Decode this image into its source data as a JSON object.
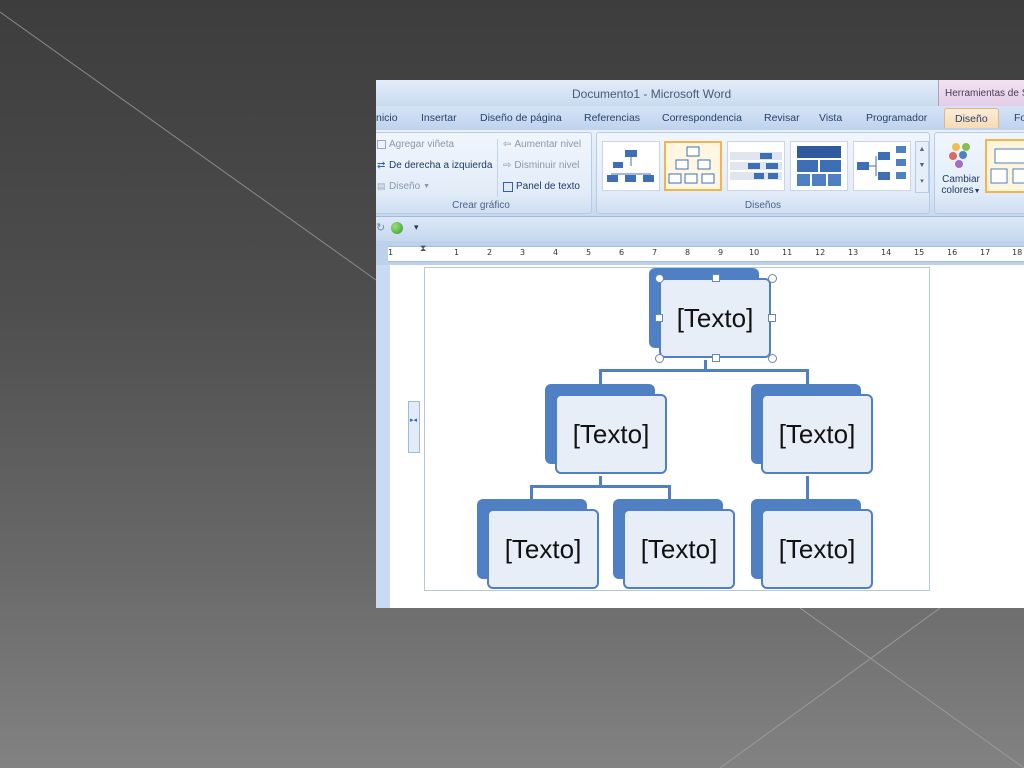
{
  "window": {
    "title": "Documento1 - Microsoft Word",
    "context_header": "Herramientas de S"
  },
  "tabs": [
    {
      "label": "nicio"
    },
    {
      "label": "Insertar"
    },
    {
      "label": "Diseño de página"
    },
    {
      "label": "Referencias"
    },
    {
      "label": "Correspondencia"
    },
    {
      "label": "Revisar"
    },
    {
      "label": "Vista"
    },
    {
      "label": "Programador"
    },
    {
      "label": "Diseño",
      "active": true
    },
    {
      "label": "Fo"
    }
  ],
  "ribbon": {
    "crear_grafico": {
      "label": "Crear gráfico",
      "agregar_vineta": "Agregar viñeta",
      "derecha_izquierda": "De derecha a izquierda",
      "diseno": "Diseño",
      "aumentar_nivel": "Aumentar nivel",
      "disminuir_nivel": "Disminuir nivel",
      "panel_texto": "Panel de texto"
    },
    "disenos": {
      "label": "Diseños"
    },
    "cambiar_colores": {
      "line1": "Cambiar",
      "line2": "colores"
    }
  },
  "ruler": {
    "numbers": [
      "1",
      "1",
      "2",
      "3",
      "4",
      "5",
      "6",
      "7",
      "8",
      "9",
      "10",
      "11",
      "12",
      "13",
      "14",
      "15",
      "16",
      "17",
      "18"
    ]
  },
  "smartart": {
    "nodes": [
      "[Texto]",
      "[Texto]",
      "[Texto]",
      "[Texto]",
      "[Texto]",
      "[Texto]"
    ]
  },
  "colors": {
    "accent": "#4f80c4",
    "node_fill": "#e8eef7",
    "ribbon": "#dbe7f6"
  }
}
